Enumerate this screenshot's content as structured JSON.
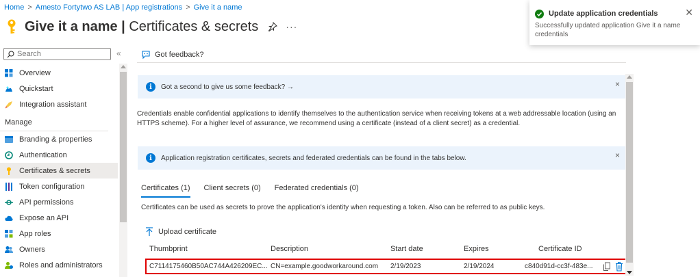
{
  "breadcrumb": [
    "Home",
    "Amesto Fortytwo AS LAB | App registrations",
    "Give it a name"
  ],
  "page": {
    "title": "Give it a name",
    "subtitle": "Certificates & secrets",
    "more": "···"
  },
  "sidebar": {
    "search_placeholder": "Search",
    "collapse": "«",
    "items_top": [
      {
        "label": "Overview"
      },
      {
        "label": "Quickstart"
      },
      {
        "label": "Integration assistant"
      }
    ],
    "section": "Manage",
    "items_manage": [
      {
        "label": "Branding & properties"
      },
      {
        "label": "Authentication"
      },
      {
        "label": "Certificates & secrets"
      },
      {
        "label": "Token configuration"
      },
      {
        "label": "API permissions"
      },
      {
        "label": "Expose an API"
      },
      {
        "label": "App roles"
      },
      {
        "label": "Owners"
      },
      {
        "label": "Roles and administrators"
      }
    ]
  },
  "main": {
    "feedback_label": "Got feedback?",
    "banner1": "Got a second to give us some feedback? →",
    "description": "Credentials enable confidential applications to identify themselves to the authentication service when receiving tokens at a web addressable location (using an HTTPS scheme). For a higher level of assurance, we recommend using a certificate (instead of a client secret) as a credential.",
    "banner2": "Application registration certificates, secrets and federated credentials can be found in the tabs below.",
    "close": "×",
    "tabs": [
      "Certificates (1)",
      "Client secrets (0)",
      "Federated credentials (0)"
    ],
    "cert_description": "Certificates can be used as secrets to prove the application's identity when requesting a token. Also can be referred to as public keys.",
    "upload_label": "Upload certificate",
    "table": {
      "headers": [
        "Thumbprint",
        "Description",
        "Start date",
        "Expires",
        "Certificate ID"
      ],
      "rows": [
        [
          "C7114175460B50AC744A426209EC...",
          "CN=example.goodworkaround.com",
          "2/19/2023",
          "2/19/2024",
          "c840d91d-cc3f-483e..."
        ]
      ]
    }
  },
  "toast": {
    "title": "Update application credentials",
    "body": "Successfully updated application Give it a name credentials",
    "close": "✕"
  },
  "colors": {
    "accent": "#0078d4",
    "highlight_border": "#e00000",
    "success": "#107c10"
  }
}
